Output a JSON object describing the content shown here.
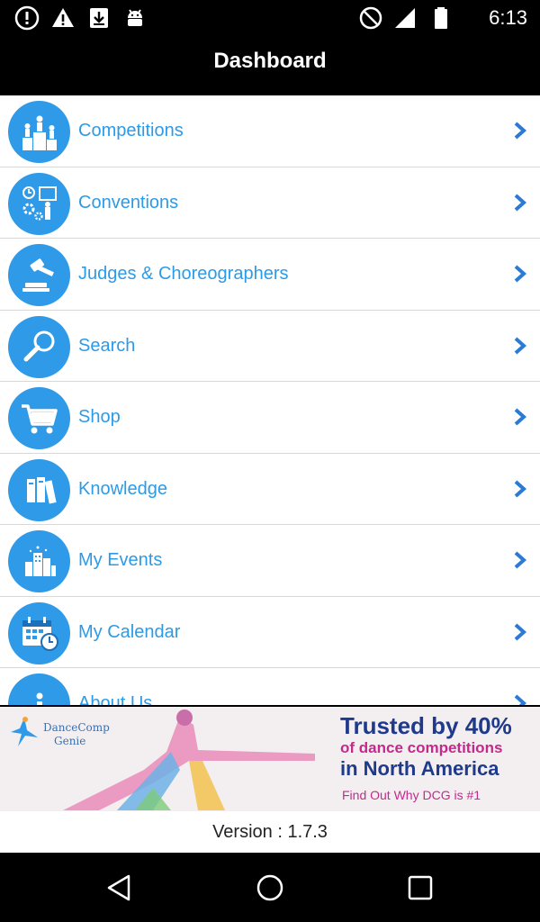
{
  "status_bar": {
    "time": "6:13",
    "left_icons": [
      "alert-circle-icon",
      "warning-icon",
      "download-icon",
      "android-icon"
    ],
    "right_icons": [
      "do-not-disturb-icon",
      "signal-icon",
      "battery-icon"
    ]
  },
  "header": {
    "title": "Dashboard"
  },
  "menu": {
    "items": [
      {
        "label": "Competitions",
        "icon": "podium-icon"
      },
      {
        "label": "Conventions",
        "icon": "conventions-icon"
      },
      {
        "label": "Judges & Choreographers",
        "icon": "gavel-icon"
      },
      {
        "label": "Search",
        "icon": "search-icon"
      },
      {
        "label": "Shop",
        "icon": "shopping-cart-icon"
      },
      {
        "label": "Knowledge",
        "icon": "books-icon"
      },
      {
        "label": "My Events",
        "icon": "city-icon"
      },
      {
        "label": "My Calendar",
        "icon": "calendar-icon"
      },
      {
        "label": "About Us",
        "icon": "info-icon"
      }
    ]
  },
  "banner": {
    "brand_line1": "DanceComp",
    "brand_line2": "Genie",
    "headline_line1": "Trusted by 40%",
    "headline_line2": "of dance competitions",
    "headline_line3": "in North America",
    "cta": "Find Out Why DCG is #1"
  },
  "footer": {
    "version": "Version : 1.7.3"
  },
  "colors": {
    "accent": "#2f9ae8",
    "label": "#2b9be8",
    "background": "#000000"
  }
}
